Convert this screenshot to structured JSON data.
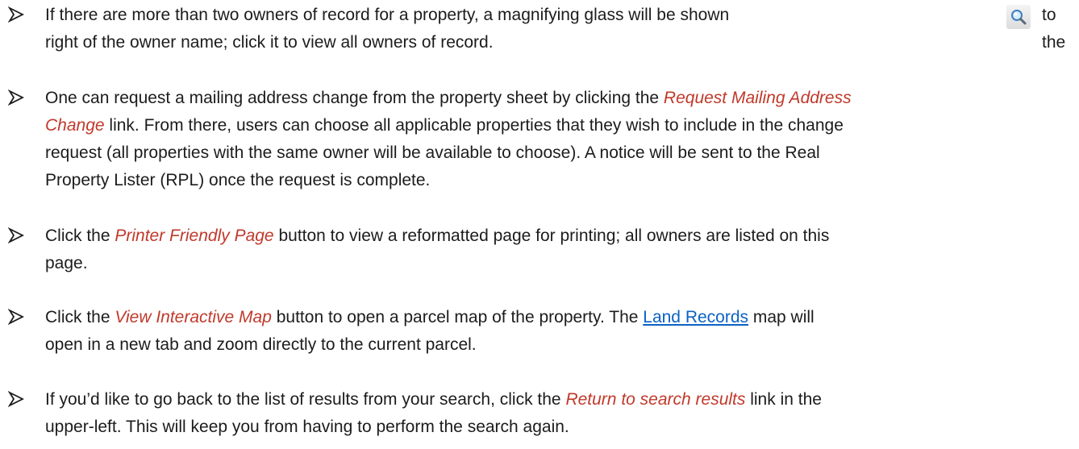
{
  "icons": {
    "bullet": "arrow-bullet-icon",
    "magnifier": "magnifying-glass-icon"
  },
  "colors": {
    "text": "#1c1c1c",
    "emphasis": "#c0392b",
    "link": "#0b62c4"
  },
  "bullets": [
    {
      "l1_a": "If there are more than two owners of record for a property, a magnifying glass will be shown",
      "l1_b": "to the",
      "l2": "right of the owner name; click it to view all owners of record."
    },
    {
      "l1_a": "One can request a mailing address change from the property sheet by clicking the ",
      "l1_em": "Request Mailing Address",
      "l2_em": "Change",
      "l2_b": " link.  From there, users can choose all applicable properties that they wish to include in the change",
      "l3": "request (all properties with the same owner will be available to choose).  A notice will be sent to the Real",
      "l4": "Property Lister (RPL) once the request is complete."
    },
    {
      "l1_a": "Click the ",
      "l1_em": "Printer Friendly Page",
      "l1_b": " button to view a reformatted page for printing; all owners are listed on this",
      "l2": "page."
    },
    {
      "l1_a": "Click the ",
      "l1_em": "View Interactive Map",
      "l1_b": " button to open a parcel map of the property.  The ",
      "l1_link": "Land Records",
      "l1_c": " map will",
      "l2": "open in a new tab and zoom directly to the current parcel."
    },
    {
      "l1_a": "If you’d like to go back to the list of results from your search, click the ",
      "l1_em": "Return to search results",
      "l1_b": " link in the",
      "l2": "upper-left.  This will keep you from having to perform the search again."
    }
  ]
}
